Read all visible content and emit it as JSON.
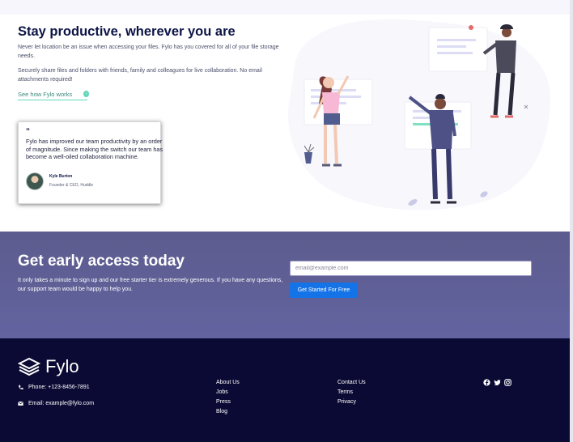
{
  "productive": {
    "title": "Stay productive, wherever you are",
    "p1": "Never let location be an issue when accessing your files. Fylo has you covered for all of your file storage needs.",
    "p2": "Securely share files and folders with friends, family and colleagues for live collaboration. No email attachments required!",
    "link": "See how Fylo works"
  },
  "testimonial": {
    "quote_mark": "“",
    "text": "Fylo has improved our team productivity by an order of magnitude. Since making the switch our team has become a well-oiled collaboration machine.",
    "name": "Kyle Burton",
    "role": "Founder & CEO, Huddle"
  },
  "early_access": {
    "title": "Get early access today",
    "text": "It only takes a minute to sign up and our free starter tier is extremely generous. If you have any questions, our support team would be happy to help you.",
    "email_placeholder": "email@example.com",
    "button": "Get Started For Free"
  },
  "footer": {
    "brand": "Fylo",
    "phone": "Phone: +123-8456-7891",
    "email": "Email: example@fylo.com",
    "col1": [
      "About Us",
      "Jobs",
      "Press",
      "Blog"
    ],
    "col2": [
      "Contact Us",
      "Terms",
      "Privacy"
    ],
    "social_icons": [
      "facebook-icon",
      "twitter-icon",
      "instagram-icon"
    ]
  },
  "colors": {
    "navy": "#0c1446",
    "teal": "#62d7b9",
    "early_bg": "#5e5e8f",
    "button_blue": "#1473e6",
    "footer_bg": "#0b0a34"
  }
}
